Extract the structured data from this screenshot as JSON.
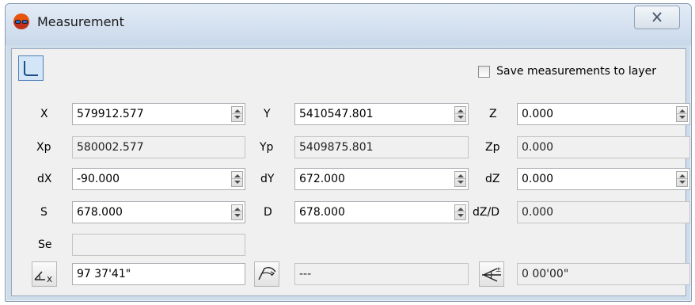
{
  "window": {
    "title": "Measurement"
  },
  "icons": {
    "app": "measurement-app-icon",
    "close": "close-icon",
    "tool": "polyline-tool-icon",
    "azimuth": "azimuth-x-icon",
    "angle": "angle-arc-icon",
    "slope": "slope-angle-icon"
  },
  "save_option": {
    "label": "Save measurements to layer",
    "checked": false
  },
  "rows": {
    "x": {
      "label": "X",
      "value": "579912.577"
    },
    "y": {
      "label": "Y",
      "value": "5410547.801"
    },
    "z": {
      "label": "Z",
      "value": "0.000"
    },
    "xp": {
      "label": "Xp",
      "value": "580002.577"
    },
    "yp": {
      "label": "Yp",
      "value": "5409875.801"
    },
    "zp": {
      "label": "Zp",
      "value": "0.000"
    },
    "dx": {
      "label": "dX",
      "value": "-90.000"
    },
    "dy": {
      "label": "dY",
      "value": "672.000"
    },
    "dz": {
      "label": "dZ",
      "value": "0.000"
    },
    "s": {
      "label": "S",
      "value": "678.000"
    },
    "d": {
      "label": "D",
      "value": "678.000"
    },
    "dzd": {
      "label": "dZ/D",
      "value": "0.000"
    },
    "se": {
      "label": "Se",
      "value": ""
    }
  },
  "angles": {
    "azimuth": "97 37'41\"",
    "angle": "---",
    "slope": "0 00'00\""
  }
}
